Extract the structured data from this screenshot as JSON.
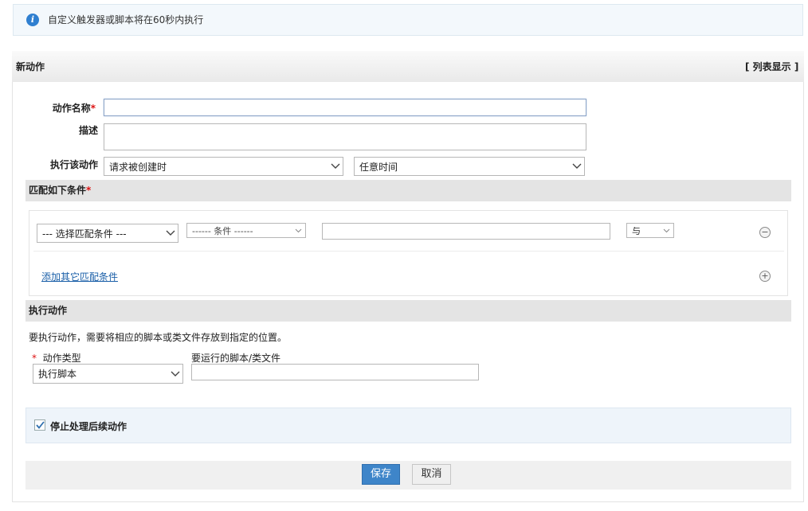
{
  "banner": {
    "message": "自定义触发器或脚本将在60秒内执行",
    "icon": "info-icon"
  },
  "panel": {
    "title": "新动作",
    "list_view": "[ 列表显示 ]"
  },
  "form": {
    "action_name_label": "动作名称",
    "required_mark": "*",
    "action_name_value": "",
    "description_label": "描述",
    "description_value": "",
    "execute_label": "执行该动作",
    "trigger_event": "请求被创建时",
    "trigger_time": "任意时间"
  },
  "conditions": {
    "section_title": "匹配如下条件",
    "select_condition": "--- 选择匹配条件 ---",
    "operator": "------ 条件 ------",
    "value": "",
    "logic": "与",
    "add_link": "添加其它匹配条件",
    "remove_symbol": "−",
    "add_symbol": "+"
  },
  "action": {
    "section_title": "执行动作",
    "note": "要执行动作，需要将相应的脚本或类文件存放到指定的位置。",
    "type_label": "动作类型",
    "type_value": "执行脚本",
    "script_label": "要运行的脚本/类文件",
    "script_value": ""
  },
  "stop": {
    "label": "停止处理后续动作",
    "checked": true
  },
  "buttons": {
    "save": "保存",
    "cancel": "取消"
  },
  "colors": {
    "accent": "#3e85c9",
    "info": "#2f7fd0",
    "link": "#1a5fa8",
    "required": "#dd1111"
  }
}
